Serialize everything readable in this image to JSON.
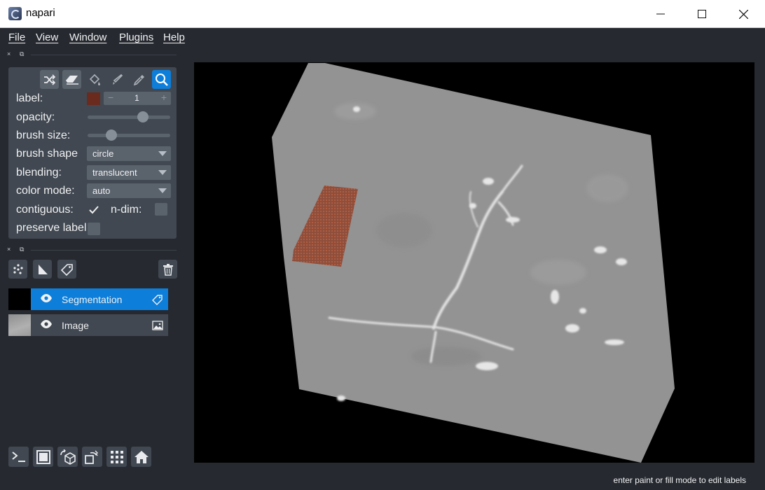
{
  "window": {
    "title": "napari",
    "controls": {
      "minimize": "—",
      "maximize": "☐",
      "close": "✕"
    }
  },
  "menu": [
    "File",
    "View",
    "Window",
    "Plugins",
    "Help"
  ],
  "dock": {
    "close_glyph": "×",
    "float_glyph": "⧉"
  },
  "layer_controls": {
    "tools": [
      "shuffle-icon",
      "eraser-icon",
      "fill-bucket-icon",
      "paintbrush-icon",
      "color-picker-icon",
      "pan-zoom-icon"
    ],
    "selected_tool": "pan-zoom-icon",
    "label": {
      "text": "label:",
      "value": "1",
      "swatch_color": "#6b2a1e",
      "decrement": "−",
      "increment": "+"
    },
    "opacity": {
      "text": "opacity:",
      "value": 0.7
    },
    "brush_size": {
      "text": "brush size:",
      "value": 0.25
    },
    "brush_shape": {
      "text": "brush shape",
      "value": "circle"
    },
    "blending": {
      "text": "blending:",
      "value": "translucent"
    },
    "color_mode": {
      "text": "color mode:",
      "value": "auto"
    },
    "contiguous": {
      "text": "contiguous:",
      "checked": true
    },
    "n_dim": {
      "text": "n-dim:",
      "checked": false
    },
    "preserve_labels": {
      "text": "preserve labels",
      "checked": false
    }
  },
  "layer_list": {
    "buttons": [
      "new-points-icon",
      "new-shapes-icon",
      "new-labels-icon",
      "delete-layer-icon"
    ],
    "layers": [
      {
        "name": "Segmentation",
        "type": "labels",
        "visible": true,
        "selected": true
      },
      {
        "name": "Image",
        "type": "image",
        "visible": true,
        "selected": false
      }
    ]
  },
  "viewer_buttons": [
    "console-icon",
    "ndisplay-icon",
    "roll-dims-icon",
    "transpose-icon",
    "grid-icon",
    "home-icon"
  ],
  "status": "enter paint or fill mode to edit labels",
  "colors": {
    "background": "#262930",
    "panel": "#414851",
    "accent": "#0d7ed9",
    "label_color": "#9b4a32"
  }
}
